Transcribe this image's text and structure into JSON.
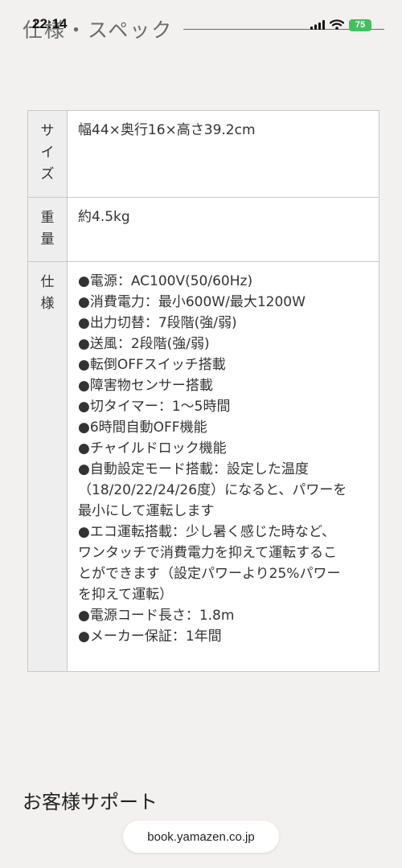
{
  "status_bar": {
    "time": "22:14",
    "battery": "75"
  },
  "page": {
    "section_heading": "仕様・スペック",
    "support_heading": "お客様サポート",
    "url": "book.yamazen.co.jp"
  },
  "spec_table": {
    "rows": [
      {
        "label_chars": [
          "サ",
          "イ",
          "ズ"
        ],
        "value": "幅44×奥行16×高さ39.2cm"
      },
      {
        "label_chars": [
          "重",
          "量"
        ],
        "value": "約4.5kg"
      },
      {
        "label_chars": [
          "仕",
          "様"
        ],
        "lines": [
          "●電源：AC100V(50/60Hz)",
          "●消費電力：最小600W/最大1200W",
          "●出力切替：7段階(強/弱)",
          "●送風：2段階(強/弱)",
          "●転倒OFFスイッチ搭載",
          "●障害物センサー搭載",
          "●切タイマー：1〜5時間",
          "●6時間自動OFF機能",
          "●チャイルドロック機能",
          "●自動設定モード搭載：設定した温度",
          "（18/20/22/24/26度）になると、パワーを",
          "最小にして運転します",
          "●エコ運転搭載：少し暑く感じた時など、",
          "ワンタッチで消費電力を抑えて運転するこ",
          "とができます（設定パワーより25%パワー",
          "を抑えて運転）",
          "●電源コード長さ：1.8m",
          "●メーカー保証：1年間"
        ]
      }
    ]
  }
}
